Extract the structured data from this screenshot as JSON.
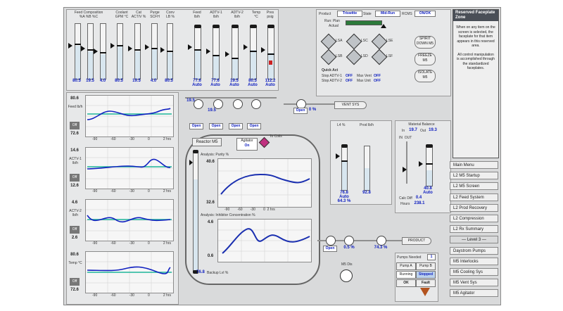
{
  "top_header": {
    "labels": [
      [
        "Feed Composition",
        "%A",
        "%B",
        "%C"
      ],
      [
        "Coolant",
        "GPM",
        "°C"
      ],
      [
        "Cat",
        "ACT/V",
        "%"
      ],
      [
        "Purge",
        "SCFH"
      ],
      [
        "Conv",
        "LB",
        "%"
      ],
      [
        "Feed",
        "lb/h"
      ],
      [
        "ADTV-1",
        "lb/h"
      ],
      [
        "ADTV-2",
        "lb/h"
      ],
      [
        "Temp",
        "°C"
      ],
      [
        "Pres",
        "psig"
      ]
    ],
    "values": [
      "80.5",
      "19.5",
      "4.0",
      "80.5",
      "19.5",
      "4.0",
      "80.5",
      "19.5",
      "4.0"
    ],
    "feed_values": [
      "77.6",
      "77.6",
      "19.5",
      "80.5",
      "112.2"
    ],
    "feed_modes": [
      "Auto",
      "Auto",
      "Auto",
      "Auto",
      "Auto"
    ]
  },
  "status": {
    "product_label": "Product",
    "product_value": "Triswitte",
    "state_label": "State",
    "state_value": "Mid-Run",
    "rcms_label": "RCMS",
    "rcms_value": "ON/OK",
    "run_plan_label": "Run: Plan",
    "actual_label": "Actual"
  },
  "sequence": {
    "lsa_labels": [
      "LSA",
      "LSB",
      "LSC",
      "LSD",
      "LSE",
      "LSF"
    ],
    "quick_title": "Quick Act",
    "rows": [
      {
        "label": "Stop ADTV-1",
        "value": "OFF",
        "label2": "Max Vent",
        "value2": "OFF"
      },
      {
        "label": "Stop ADTV-2",
        "value": "OFF",
        "label2": "Max Unit",
        "value2": "OFF"
      }
    ],
    "buttons": [
      "SPIRIT DOWN M5",
      "FREEZE M5",
      "ISOLATE M5"
    ]
  },
  "faceplate": {
    "title": "Reserved Faceplate Zone",
    "text1": "When on any item on the screen is selected, the faceplate for that item appears in this reserved area.",
    "text2": "All control manipulation is accomplished through the standardized faceplates."
  },
  "side_trends": [
    {
      "name": "Feed lb/h",
      "top": "80.6",
      "bottom": "72.6",
      "mode": "Off"
    },
    {
      "name": "ACTV-1 lb/h",
      "top": "14.6",
      "bottom": "12.6",
      "mode": "Off"
    },
    {
      "name": "ACTV-2 lb/h",
      "top": "4.6",
      "bottom": "2.6",
      "mode": "Off"
    },
    {
      "name": "Temp °C",
      "top": "80.6",
      "bottom": "72.6",
      "mode": "Off"
    }
  ],
  "trend_axis": [
    "-90",
    "-60",
    "-30",
    "0",
    "2 hrs"
  ],
  "valves": {
    "labels": [
      "Open",
      "Open",
      "Open",
      "Open"
    ],
    "percents": [
      "19.5",
      "19.5",
      "19.5",
      "19.5"
    ],
    "vent_label": "VENT SYS",
    "vent_open": "Open",
    "vent_value": "0 %"
  },
  "reactor": {
    "title": "Reactor M5",
    "agitator_label": "Agitator",
    "agitator_value": "On",
    "to_coils": "To Coils",
    "trend1_title": "Analysis: Purity %",
    "trend1_top": "40.6",
    "trend1_bottom": "32.6",
    "trend2_title": "Analysis: Inhibitor Concentration %",
    "trend2_top": "4.6",
    "trend2_bottom": "0.6",
    "level_label": "Backup Lvl %",
    "level_value": "76.8"
  },
  "outlet": {
    "l4_label": "L4 %",
    "prod_label": "Prod lb/h",
    "l4_value": "76.8",
    "l4_mode": "Auto",
    "l4_pct": "64.3 %",
    "prod_value": "92.8",
    "product_label": "PRODUCT",
    "valve1_open": "Open",
    "valve1_pct": "0.5 %",
    "valve2_pct": "74.3 %",
    "valve2_open": "Open",
    "m5_dis_label": "M5 Dis"
  },
  "material_balance": {
    "title": "Material Balance",
    "in_label": "In",
    "in_value": "19.7",
    "out_label": "Out",
    "out_value": "19.3",
    "calc_label": "Calc Diff",
    "calc_value": "0.4",
    "hours_label": "Hours",
    "hours_value": "238.1",
    "bar_value": "40.8",
    "bar_mode": "Auto"
  },
  "pumps": {
    "needed_label": "Pumps Needed",
    "needed_value": "1",
    "pump_a": "Pump A",
    "pump_b": "Pump B",
    "running": "Running",
    "stopped": "Stopped",
    "ok": "OK",
    "fault": "Fault"
  },
  "nav": [
    "Main Menu",
    "L2 M5 Startup",
    "L2 M5 Screen",
    "L2 Feed System",
    "L2 Prod Recovery",
    "L2 Compression",
    "L2 Rx Summary",
    "Level 3",
    "Daystrom Pumps",
    "M5 Interlocks",
    "M5 Cooling Sys",
    "M5 Vent Sys",
    "M5 Agitator"
  ],
  "colors": {
    "process_value": "#1020c0",
    "setpoint": "#1fb59a",
    "alarm": "#cc2222"
  }
}
